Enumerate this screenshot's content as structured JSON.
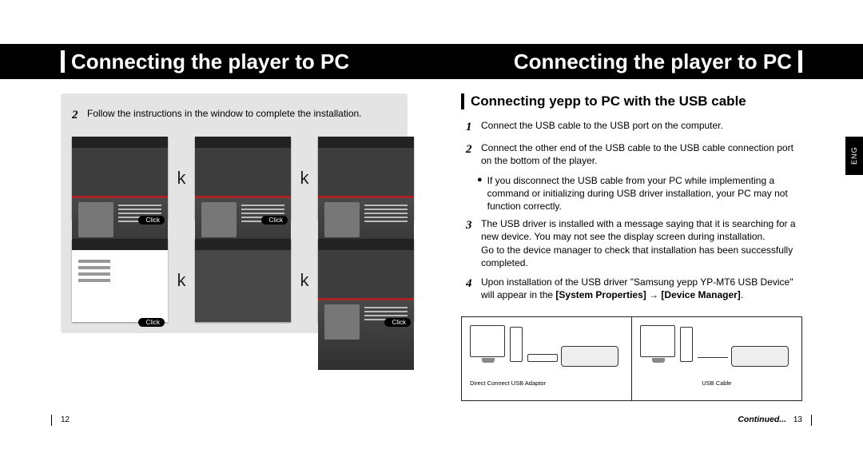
{
  "header": {
    "title_left": "Connecting the player to PC",
    "title_right": "Connecting the player to PC"
  },
  "left_page": {
    "step2_num": "2",
    "step2_text": "Follow the instructions in the window to complete the installation.",
    "click_label": "Click",
    "page_number": "12"
  },
  "right_page": {
    "subheading": "Connecting yepp to PC with the USB cable",
    "lang_tab": "ENG",
    "step1_num": "1",
    "step1_text": "Connect the USB cable to the USB port on the computer.",
    "step2_num": "2",
    "step2_text": "Connect the other end of the USB cable to the USB cable connection port on the bottom of the player.",
    "step2_bullet": "If you disconnect the USB cable from your PC while implementing a command or initializing during USB driver installation, your PC may not function correctly.",
    "step3_num": "3",
    "step3_text_a": "The USB driver is installed with a message saying that it is searching for a new device. You may not see the display screen during installation.",
    "step3_text_b": "Go to the device manager to check that installation has been successfully completed.",
    "step4_num": "4",
    "step4_text_pre": "Upon installation of the USB driver \"Samsung yepp YP-MT6 USB Device\" will appear in the ",
    "step4_bold": "[System Properties] → [Device Manager]",
    "step4_text_post": ".",
    "diagram_caption_left": "Direct Connect USB Adaptor",
    "diagram_caption_right": "USB Cable",
    "continued": "Continued...",
    "page_number": "13"
  }
}
